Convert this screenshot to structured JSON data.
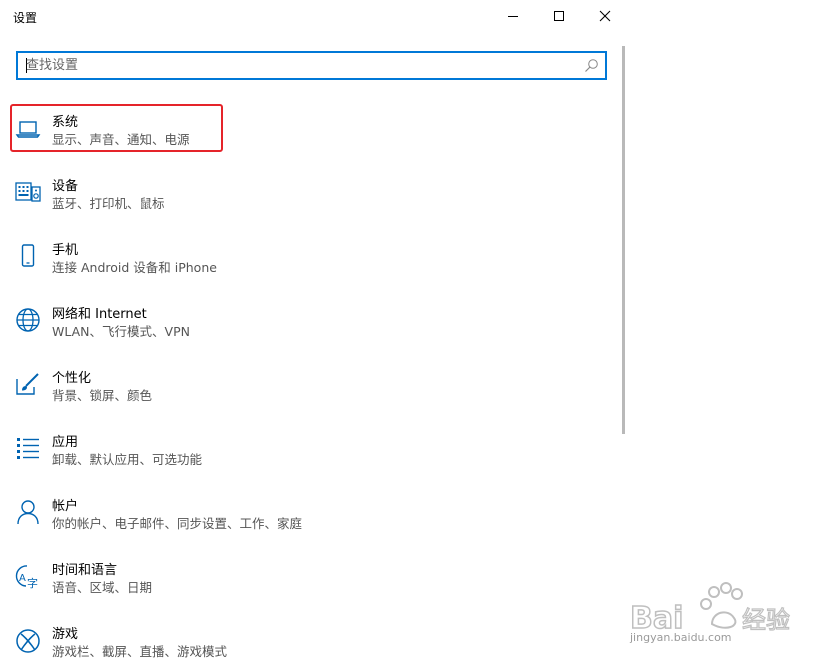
{
  "window": {
    "title": "设置",
    "controls": [
      "minimize",
      "maximize",
      "close"
    ]
  },
  "search": {
    "placeholder": "查找设置",
    "value": ""
  },
  "categories": [
    {
      "name": "系统",
      "desc": "显示、声音、通知、电源",
      "icon": "laptop-icon"
    },
    {
      "name": "设备",
      "desc": "蓝牙、打印机、鼠标",
      "icon": "keyboard-speaker-icon"
    },
    {
      "name": "手机",
      "desc": "连接 Android 设备和 iPhone",
      "icon": "phone-icon"
    },
    {
      "name": "网络和 Internet",
      "desc": "WLAN、飞行模式、VPN",
      "icon": "globe-icon"
    },
    {
      "name": "个性化",
      "desc": "背景、锁屏、颜色",
      "icon": "paint-brush-icon"
    },
    {
      "name": "应用",
      "desc": "卸载、默认应用、可选功能",
      "icon": "apps-list-icon"
    },
    {
      "name": "帐户",
      "desc": "你的帐户、电子邮件、同步设置、工作、家庭",
      "icon": "person-icon"
    },
    {
      "name": "时间和语言",
      "desc": "语音、区域、日期",
      "icon": "time-language-icon"
    },
    {
      "name": "游戏",
      "desc": "游戏栏、截屏、直播、游戏模式",
      "icon": "xbox-icon"
    }
  ],
  "watermark": {
    "logo": "Bai经验",
    "url": "jingyan.baidu.com"
  },
  "colors": {
    "accent": "#0078d7",
    "highlight_box": "#e5242a"
  }
}
